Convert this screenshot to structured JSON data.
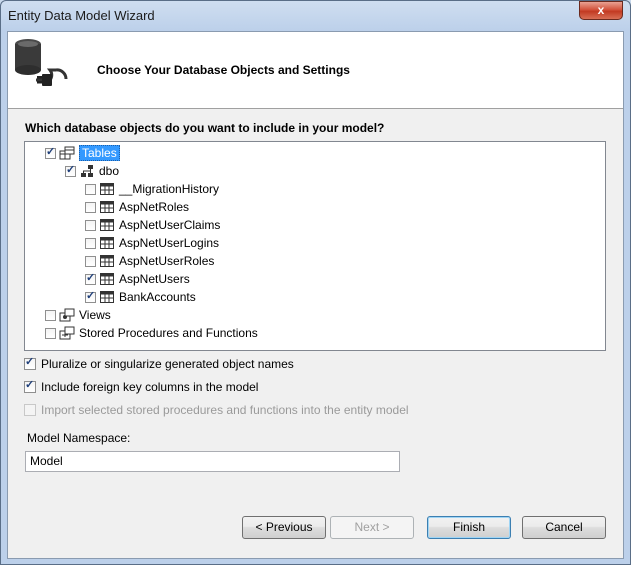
{
  "window": {
    "title": "Entity Data Model Wizard",
    "close_glyph": "x"
  },
  "header": {
    "title": "Choose Your Database Objects and Settings",
    "icon": "database-connection-icon"
  },
  "question": "Which database objects do you want to include in your model?",
  "tree": {
    "tables": {
      "label": "Tables",
      "checked": true
    },
    "schema": {
      "label": "dbo",
      "checked": true
    },
    "items": [
      {
        "label": "__MigrationHistory",
        "checked": false
      },
      {
        "label": "AspNetRoles",
        "checked": false
      },
      {
        "label": "AspNetUserClaims",
        "checked": false
      },
      {
        "label": "AspNetUserLogins",
        "checked": false
      },
      {
        "label": "AspNetUserRoles",
        "checked": false
      },
      {
        "label": "AspNetUsers",
        "checked": true
      },
      {
        "label": "BankAccounts",
        "checked": true
      }
    ],
    "views": {
      "label": "Views",
      "checked": false
    },
    "procs": {
      "label": "Stored Procedures and Functions",
      "checked": false
    }
  },
  "options": {
    "pluralize": {
      "label": "Pluralize or singularize generated object names",
      "checked": true
    },
    "foreign_keys": {
      "label": "Include foreign key columns in the model",
      "checked": true
    },
    "import_procs": {
      "label": "Import selected stored procedures and functions into the entity model",
      "checked": false,
      "disabled": true
    }
  },
  "namespace": {
    "label": "Model Namespace:",
    "value": "Model"
  },
  "buttons": {
    "previous": "< Previous",
    "next": "Next >",
    "finish": "Finish",
    "cancel": "Cancel"
  }
}
